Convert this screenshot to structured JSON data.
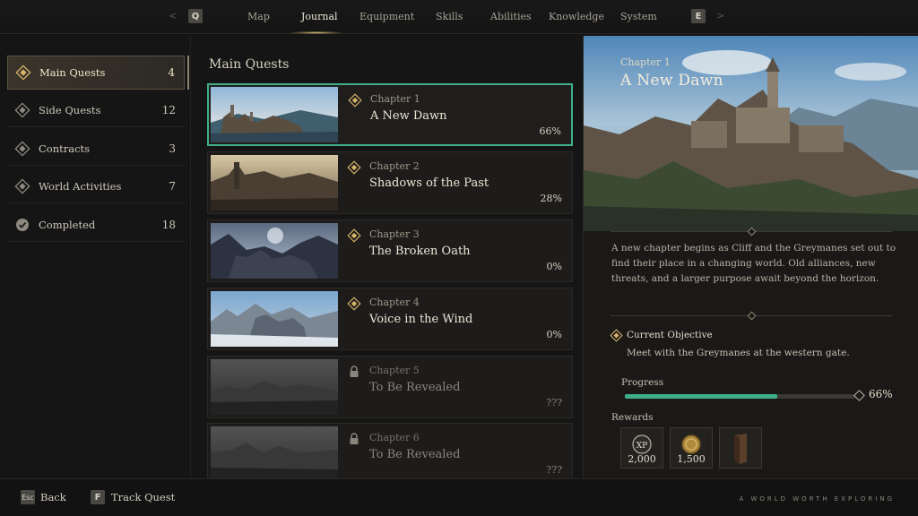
{
  "topbar": {
    "left_key": "Q",
    "right_key": "E",
    "tabs": [
      {
        "label": "Map"
      },
      {
        "label": "Journal"
      },
      {
        "label": "Equipment"
      },
      {
        "label": "Skills"
      },
      {
        "label": "Abilities"
      },
      {
        "label": "Knowledge"
      },
      {
        "label": "System"
      }
    ],
    "active_tab": "Journal"
  },
  "sidebar": {
    "items": [
      {
        "label": "Main Quests",
        "count": "4",
        "icon": "diamond-icon"
      },
      {
        "label": "Side Quests",
        "count": "12",
        "icon": "diamond-icon"
      },
      {
        "label": "Contracts",
        "count": "3",
        "icon": "diamond-icon"
      },
      {
        "label": "World Activities",
        "count": "7",
        "icon": "diamond-icon"
      },
      {
        "label": "Completed",
        "count": "18",
        "icon": "check-icon"
      }
    ]
  },
  "list": {
    "title": "Main Quests",
    "quests": [
      {
        "chapter": "Chapter 1",
        "name": "A New Dawn",
        "progress": "66%",
        "locked": false
      },
      {
        "chapter": "Chapter 2",
        "name": "Shadows of the Past",
        "progress": "28%",
        "locked": false
      },
      {
        "chapter": "Chapter 3",
        "name": "The Broken Oath",
        "progress": "0%",
        "locked": false
      },
      {
        "chapter": "Chapter 4",
        "name": "Voice in the Wind",
        "progress": "0%",
        "locked": false
      },
      {
        "chapter": "Chapter 5",
        "name": "To Be Revealed",
        "progress": "???",
        "locked": true
      },
      {
        "chapter": "Chapter 6",
        "name": "To Be Revealed",
        "progress": "???",
        "locked": true
      }
    ]
  },
  "detail": {
    "chapter": "Chapter 1",
    "title": "A New Dawn",
    "description": "A new chapter begins as Cliff and the Greymanes set out to find their place in a changing world. Old alliances, new threats, and a larger purpose await beyond the horizon.",
    "objective_label": "Current Objective",
    "objective_text": "Meet with the Greymanes at the western gate.",
    "progress_label": "Progress",
    "progress_value": 0.66,
    "progress_text": "66%",
    "rewards_label": "Rewards",
    "rewards": [
      {
        "icon": "xp-icon",
        "value": "2,000",
        "icon_text": "XP"
      },
      {
        "icon": "gold-coin-icon",
        "value": "1,500"
      },
      {
        "icon": "scroll-item-icon",
        "value": ""
      }
    ]
  },
  "bottombar": {
    "back_key": "Esc",
    "back_label": "Back",
    "track_key": "F",
    "track_label": "Track Quest",
    "tagline": "A WORLD WORTH EXPLORING"
  },
  "colors": {
    "accent_green": "#3fae89",
    "accent_gold": "#d9b56a"
  }
}
